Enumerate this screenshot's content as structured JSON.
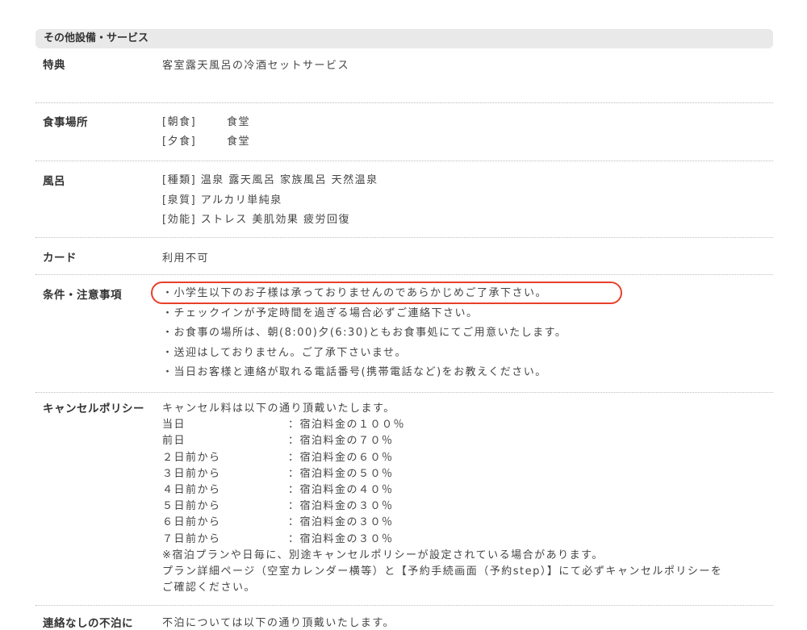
{
  "section_title": "その他設備・サービス",
  "rows": {
    "tokuten": {
      "label": "特典",
      "value": "客室露天風呂の冷酒セットサービス"
    },
    "shokuji": {
      "label": "食事場所",
      "lines": [
        {
          "tag": "[朝食]",
          "value": "食堂"
        },
        {
          "tag": "[夕食]",
          "value": "食堂"
        }
      ]
    },
    "furo": {
      "label": "風呂",
      "lines": [
        "[種類] 温泉 露天風呂 家族風呂 天然温泉",
        "[泉質] アルカリ単純泉",
        "[効能] ストレス 美肌効果 疲労回復"
      ]
    },
    "card": {
      "label": "カード",
      "value": "利用不可"
    },
    "jouken": {
      "label": "条件・注意事項",
      "lines": [
        "・小学生以下のお子様は承っておりませんのであらかじめご了承下さい。",
        "・チェックインが予定時間を過ぎる場合必ずご連絡下さい。",
        "・お食事の場所は、朝(8:00)夕(6:30)ともお食事処にてご用意いたします。",
        "・送迎はしておりません。ご了承下さいませ。",
        "・当日お客様と連絡が取れる電話番号(携帯電話など)をお教えください。"
      ]
    },
    "cancel": {
      "label": "キャンセルポリシー",
      "intro": "キャンセル料は以下の通り頂戴いたします。",
      "items": [
        {
          "day": "当日",
          "rate": "：宿泊料金の１００％"
        },
        {
          "day": "前日",
          "rate": "：宿泊料金の７０％"
        },
        {
          "day": "２日前から",
          "rate": "：宿泊料金の６０％"
        },
        {
          "day": "３日前から",
          "rate": "：宿泊料金の５０％"
        },
        {
          "day": "４日前から",
          "rate": "：宿泊料金の４０％"
        },
        {
          "day": "５日前から",
          "rate": "：宿泊料金の３０％"
        },
        {
          "day": "６日前から",
          "rate": "：宿泊料金の３０％"
        },
        {
          "day": "７日前から",
          "rate": "：宿泊料金の３０％"
        }
      ],
      "notes": [
        "※宿泊プランや日毎に、別途キャンセルポリシーが設定されている場合があります。",
        "プラン詳細ページ（空室カレンダー横等）と【予約手続画面（予約step）】にて必ずキャンセルポリシーを",
        "ご確認ください。"
      ]
    },
    "contact": {
      "label": "連絡なしの不泊に",
      "value": "不泊については以下の通り頂戴いたします。"
    }
  },
  "colors": {
    "highlight": "#e8402a",
    "header_bg": "#e9e9e9"
  }
}
